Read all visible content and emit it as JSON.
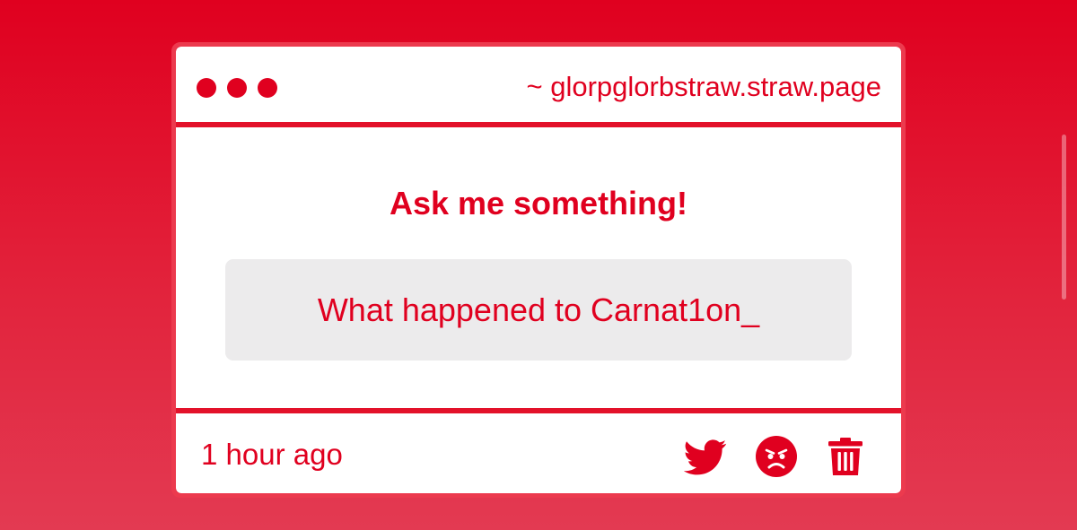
{
  "header": {
    "url": "~ glorpglorbstraw.straw.page"
  },
  "main": {
    "title": "Ask me something!",
    "question": "What happened to Carnat1on_"
  },
  "footer": {
    "timestamp": "1 hour ago",
    "actions": [
      {
        "icon": "twitter-icon"
      },
      {
        "icon": "angry-face-icon"
      },
      {
        "icon": "trash-icon"
      }
    ]
  },
  "colors": {
    "accent": "#e0001f",
    "question_bg": "#ecebec",
    "card_bg": "#ffffff"
  }
}
